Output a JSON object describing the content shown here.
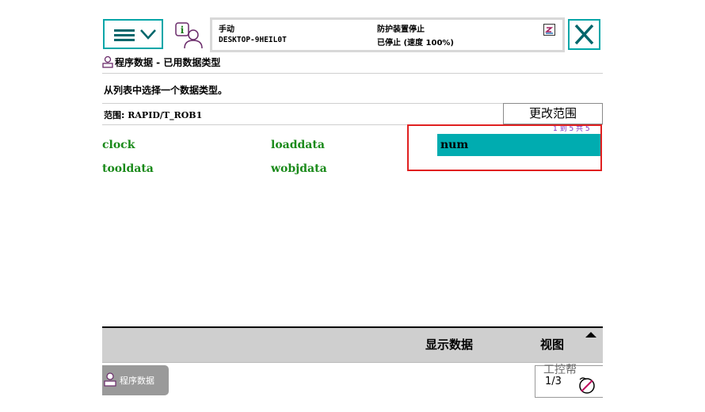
{
  "header": {
    "mode": "手动",
    "controller": "DESKTOP-9HEIL0T",
    "safety_status": "防护装置停止",
    "run_state": "已停止 (速度 100%)"
  },
  "page": {
    "title": "程序数据 - 已用数据类型",
    "instruction": "从列表中选择一个数据类型。",
    "scope_label": "范围:",
    "scope_value": "RAPID/T_ROB1",
    "change_scope_button": "更改范围",
    "pager": "1 到 5 共 5"
  },
  "data_types": {
    "items": [
      {
        "label": "clock"
      },
      {
        "label": "loaddata"
      },
      {
        "label": "num",
        "selected": true
      },
      {
        "label": "tooldata"
      },
      {
        "label": "wobjdata"
      }
    ]
  },
  "commands": {
    "show_data": "显示数据",
    "view": "视图"
  },
  "taskbar": {
    "program_data": "程序数据",
    "quickset_fraction": "1/3",
    "watermark": "工控帮"
  },
  "colors": {
    "accent": "#00a6a8",
    "selection": "#00acb0",
    "list_text": "#1a8a1a",
    "highlight_frame": "#e02020"
  }
}
